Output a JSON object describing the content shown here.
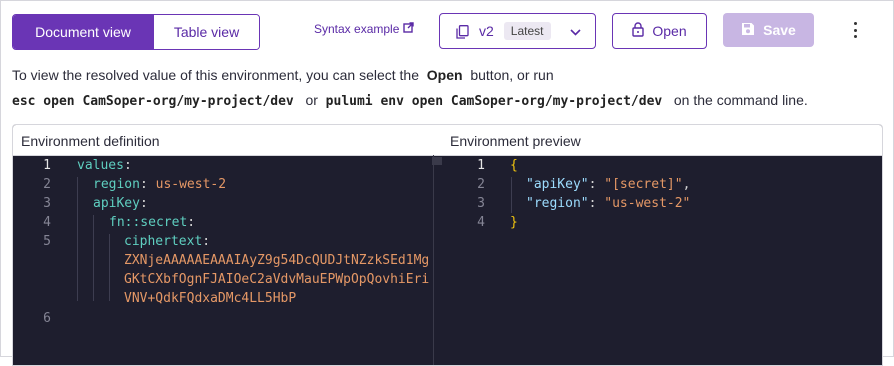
{
  "toolbar": {
    "document_view": "Document view",
    "table_view": "Table view",
    "syntax_example": "Syntax example",
    "version": "v2",
    "version_tag": "Latest",
    "open": "Open",
    "save": "Save"
  },
  "description": {
    "line1_prefix": "To view the resolved value of this environment, you can select the",
    "line1_bold": "Open",
    "line1_suffix": "button, or run",
    "cmd1": "esc open CamSoper-org/my-project/dev",
    "or": "or",
    "cmd2": "pulumi env open CamSoper-org/my-project/dev",
    "line2_suffix": "on the command line."
  },
  "editor": {
    "left_title": "Environment definition",
    "right_title": "Environment preview",
    "left_lines": {
      "n1": "1",
      "n2": "2",
      "n3": "3",
      "n4": "4",
      "n5": "5",
      "n6": "6",
      "values": "values",
      "region_key": "region",
      "region_val": "us-west-2",
      "apikey_key": "apiKey",
      "fn_key": "fn::secret",
      "cipher_key": "ciphertext",
      "cipher_1": "ZXNjeAAAAAEAAAIAyZ9g54DcQUDJtNZzkSEd1Mg",
      "cipher_2": "GKtCXbfOgnFJAIOeC2aVdvMauEPWpOpQovhiEri",
      "cipher_3": "VNV+QdkFQdxaDMc4LL5HbP"
    },
    "right_lines": {
      "n1": "1",
      "n2": "2",
      "n3": "3",
      "n4": "4",
      "open_brace": "{",
      "apikey_key": "\"apiKey\"",
      "apikey_val": "\"[secret]\"",
      "region_key": "\"region\"",
      "region_val": "\"us-west-2\"",
      "close_brace": "}"
    }
  },
  "colors": {
    "accent": "#6a35b5",
    "editor_bg": "#1e1e2e"
  }
}
